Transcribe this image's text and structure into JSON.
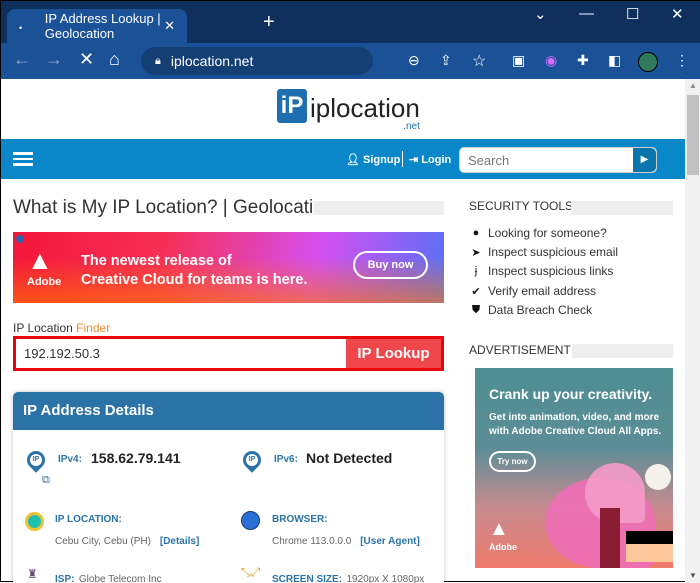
{
  "browser": {
    "tab_title": "IP Address Lookup | Geolocation",
    "url": "iplocation.net"
  },
  "site": {
    "logo_text": "iplocation",
    "logo_suffix": ".net",
    "logo_mark": "iP",
    "signup": "Signup",
    "login": "Login",
    "search_placeholder": "Search"
  },
  "main": {
    "title": "What is My IP Location? | Geolocation",
    "ad": {
      "brand": "Adobe",
      "line1": "The newest release of",
      "line2": "Creative Cloud for teams is here.",
      "cta": "Buy now"
    },
    "finder": {
      "label": "IP Location",
      "label_accent": "Finder",
      "value": "192.192.50.3",
      "button": "IP Lookup"
    },
    "card": {
      "title": "IP Address Details",
      "ipv4_label": "IPv4:",
      "ipv4": "158.62.79.141",
      "ipv6_label": "IPv6:",
      "ipv6": "Not Detected",
      "location_label": "IP LOCATION:",
      "location": "Cebu City, Cebu (PH)",
      "details_link": "[Details]",
      "browser_label": "BROWSER:",
      "browser": "Chrome 113.0.0.0",
      "ua_link": "[User Agent]",
      "isp_label": "ISP:",
      "isp": "Globe Telecom Inc",
      "screen_label": "SCREEN SIZE:",
      "screen": "1920px X 1080px"
    }
  },
  "sidebar": {
    "security_title": "SECURITY TOOLS",
    "tools": [
      {
        "label": "Looking for someone?",
        "icon": "user-icon"
      },
      {
        "label": "Inspect suspicious email",
        "icon": "paper-plane-icon"
      },
      {
        "label": "Inspect suspicious links",
        "icon": "hook-icon"
      },
      {
        "label": "Verify email address",
        "icon": "check-icon"
      },
      {
        "label": "Data Breach Check",
        "icon": "shield-icon"
      }
    ],
    "ad_title": "ADVERTISEMENT",
    "ad": {
      "headline": "Crank up your creativity.",
      "line1": "Get into animation, video, and more",
      "line2": "with Adobe Creative Cloud All Apps.",
      "cta": "Try now",
      "brand": "Adobe"
    }
  }
}
